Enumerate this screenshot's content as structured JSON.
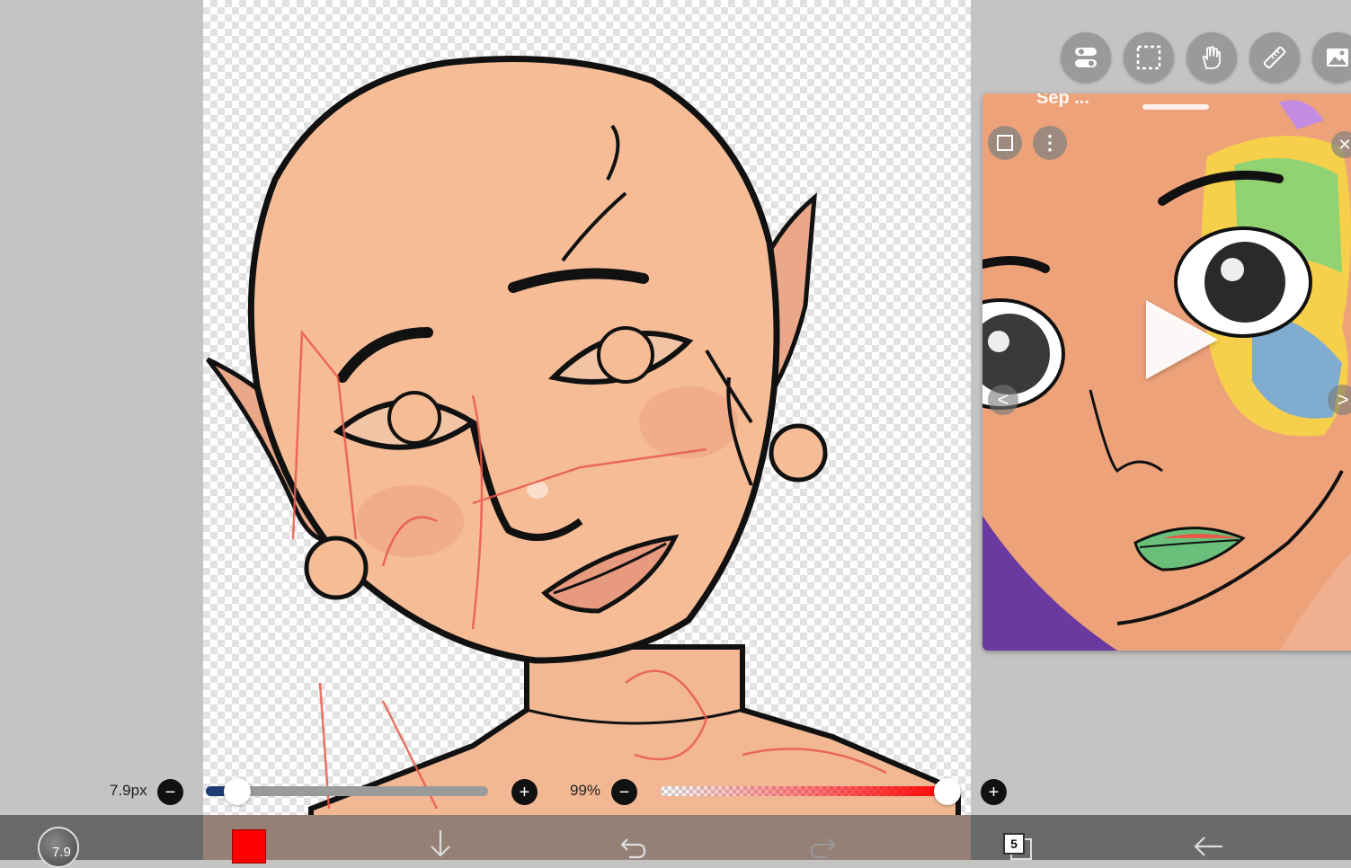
{
  "app": {
    "brush_size_label": "7.9px",
    "brush_opacity_label": "99%",
    "brush_size_value": 7.9,
    "brush_opacity_value": 99,
    "brush_preview_text": "7.9",
    "layer_count": "5",
    "active_color": "#ff0000"
  },
  "toolbar": {
    "tools": [
      {
        "name": "adjust-toggle-icon"
      },
      {
        "name": "selection-icon"
      },
      {
        "name": "hand-icon"
      },
      {
        "name": "ruler-icon"
      },
      {
        "name": "image-icon"
      }
    ]
  },
  "reference_window": {
    "title": "Sep ..."
  },
  "sliders": {
    "size_fraction": 0.11,
    "opacity_fraction": 0.99
  },
  "colors": {
    "skin": "#f6bc96",
    "sketch": "#e85a4a",
    "toolbar_bg": "#6a6a6a",
    "workspace_bg": "#c4c4c4"
  }
}
